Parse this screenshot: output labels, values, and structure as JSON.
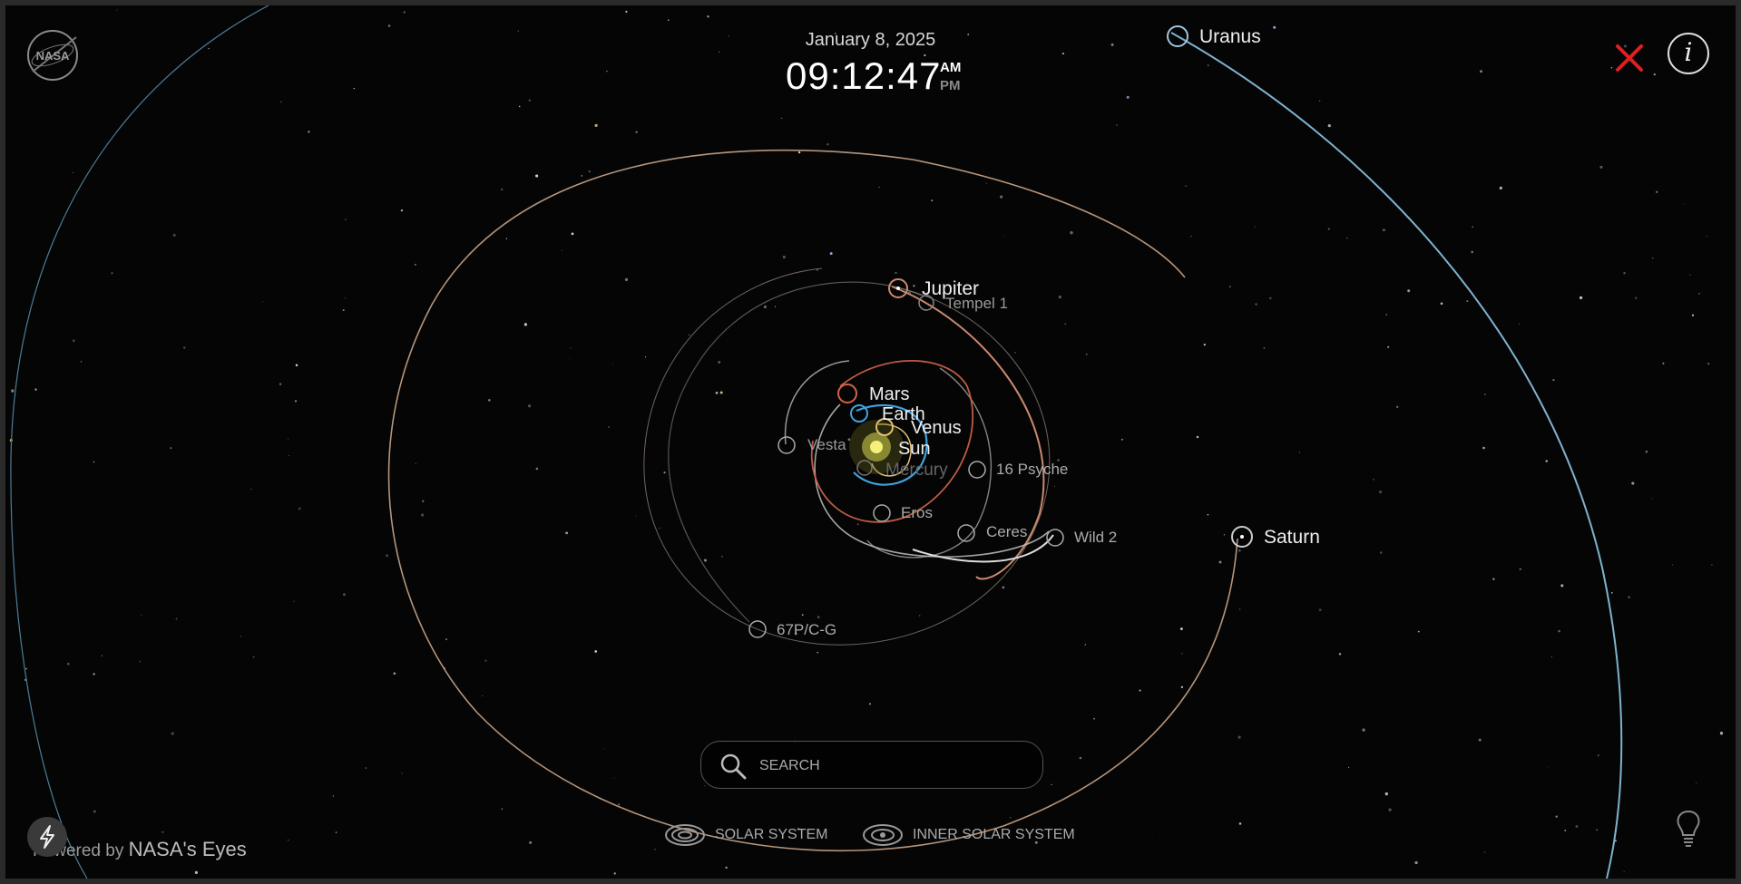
{
  "header": {
    "date": "January 8, 2025",
    "time": "09:12:47",
    "am_label": "AM",
    "pm_label": "PM",
    "active_period": "AM",
    "logo_text": "NASA"
  },
  "bodies": {
    "sun": "Sun",
    "mercury": "Mercury",
    "venus": "Venus",
    "earth": "Earth",
    "mars": "Mars",
    "jupiter": "Jupiter",
    "saturn": "Saturn",
    "uranus": "Uranus",
    "tempel1": "Tempel 1",
    "vesta": "Vesta",
    "psyche": "16 Psyche",
    "eros": "Eros",
    "ceres": "Ceres",
    "wild2": "Wild 2",
    "comet67p": "67P/C-G"
  },
  "search": {
    "placeholder": "SEARCH",
    "value": ""
  },
  "views": {
    "solar_system": "SOLAR SYSTEM",
    "inner_solar_system": "INNER SOLAR SYSTEM"
  },
  "footer": {
    "powered_prefix": "Powered by",
    "powered_brand": "NASA's Eyes"
  },
  "icons": {
    "logo": "nasa-logo-icon",
    "close": "close-icon",
    "info": "info-icon",
    "search": "search-icon",
    "view": "orbit-view-icon",
    "lightning": "lightning-icon",
    "lightbulb": "lightbulb-icon"
  },
  "colors": {
    "close": "#e02020",
    "uranus_orbit": "#7fb3cf",
    "saturn_orbit": "#c9a58a",
    "jupiter_orbit": "#c98a6e",
    "earth": "#3fa3e0",
    "mars": "#d0654a",
    "sun": "#f5f07a"
  }
}
